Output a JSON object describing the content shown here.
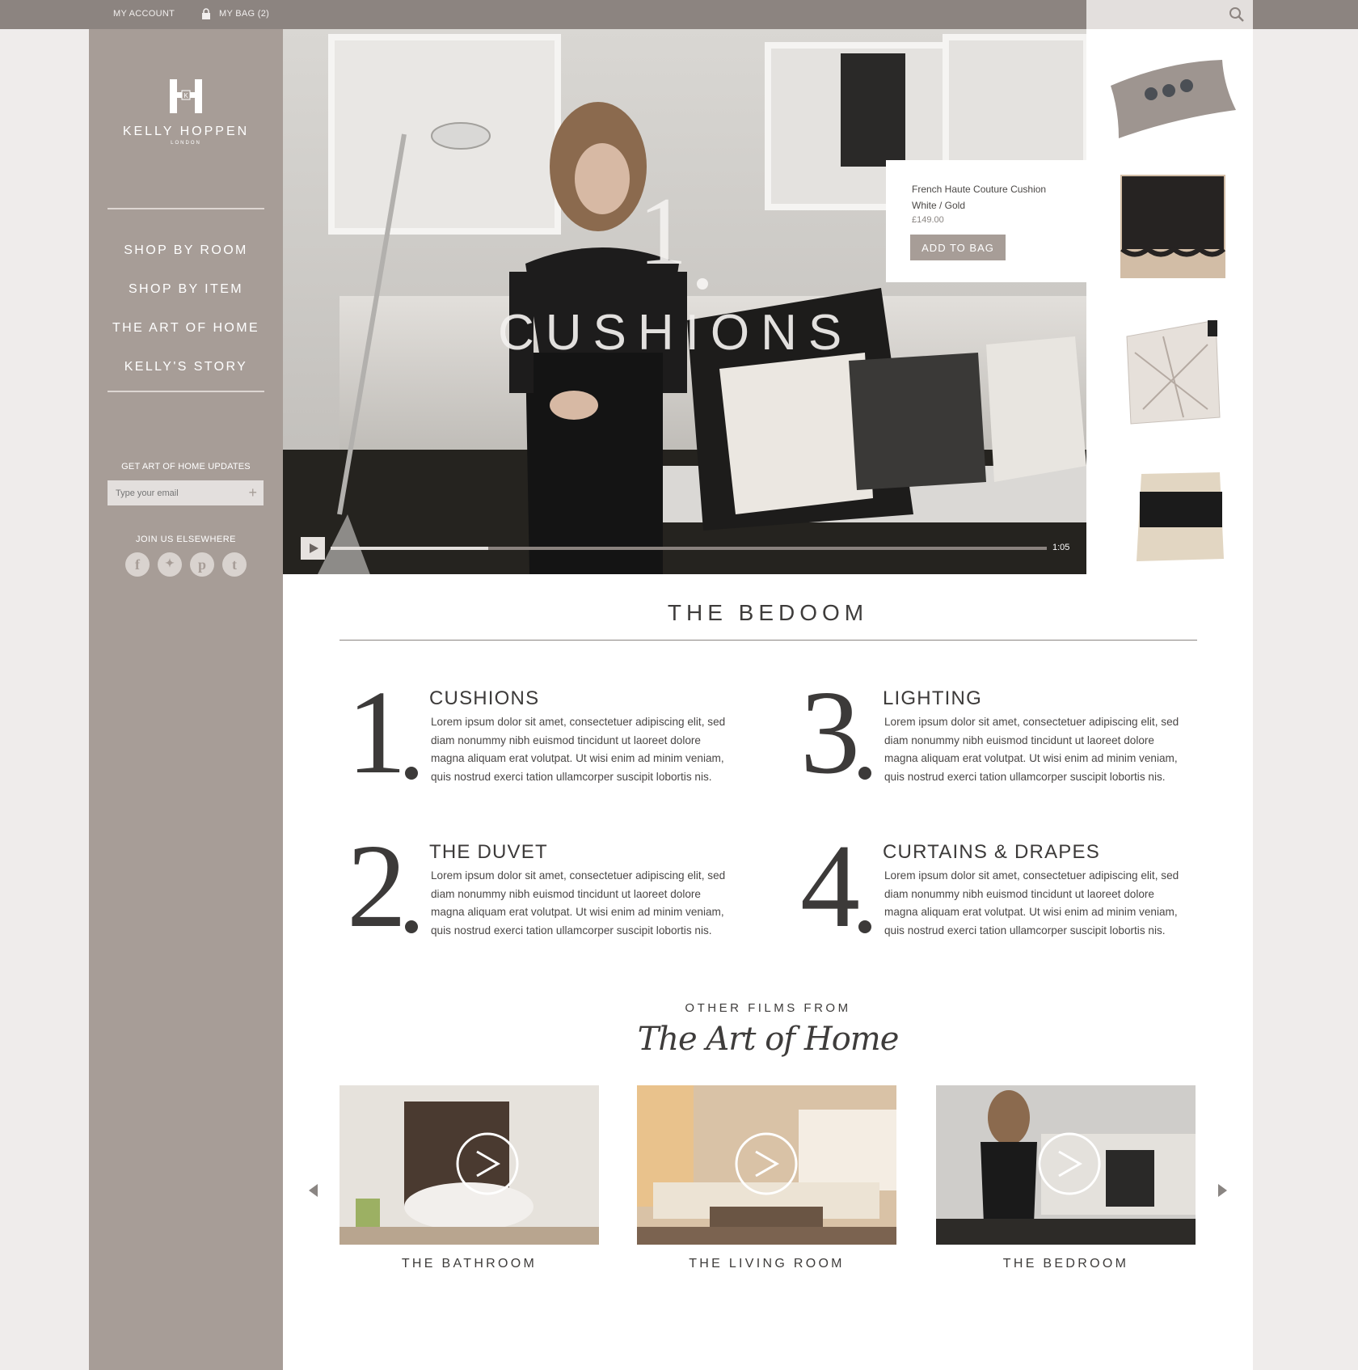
{
  "topbar": {
    "my_account": "MY ACCOUNT",
    "my_bag": "MY BAG (2)"
  },
  "brand": {
    "name": "KELLY HOPPEN",
    "sub": "LONDON"
  },
  "nav": [
    {
      "label": "SHOP BY ROOM"
    },
    {
      "label": "SHOP BY ITEM"
    },
    {
      "label": "THE ART OF HOME"
    },
    {
      "label": "KELLY'S STORY"
    }
  ],
  "newsletter": {
    "label": "GET ART OF HOME UPDATES",
    "placeholder": "Type your email"
  },
  "social": {
    "label": "JOIN US ELSEWHERE",
    "items": [
      "facebook-icon",
      "twitter-icon",
      "pinterest-icon",
      "tumblr-icon"
    ]
  },
  "video": {
    "number": "1",
    "title": "CUSHIONS",
    "time": "1:05",
    "progress": 0.22
  },
  "popup": {
    "name": "French Haute Couture Cushion",
    "variant": "White / Gold",
    "price": "£149.00",
    "button": "ADD TO BAG"
  },
  "section_title": "THE BEDOOM",
  "items": [
    {
      "num": "1",
      "title": "CUSHIONS",
      "text": "Lorem ipsum dolor sit amet, consectetuer adipiscing elit, sed diam nonummy nibh euismod tincidunt ut laoreet dolore magna aliquam erat volutpat. Ut wisi enim ad minim veniam, quis nostrud exerci tation ullamcorper suscipit lobortis nis."
    },
    {
      "num": "2",
      "title": "THE DUVET",
      "text": "Lorem ipsum dolor sit amet, consectetuer adipiscing elit, sed diam nonummy nibh euismod tincidunt ut laoreet dolore magna aliquam erat volutpat. Ut wisi enim ad minim veniam, quis nostrud exerci tation ullamcorper suscipit lobortis nis."
    },
    {
      "num": "3",
      "title": "LIGHTING",
      "text": "Lorem ipsum dolor sit amet, consectetuer adipiscing elit, sed diam nonummy nibh euismod tincidunt ut laoreet dolore magna aliquam erat volutpat. Ut wisi enim ad minim veniam, quis nostrud exerci tation ullamcorper suscipit lobortis nis."
    },
    {
      "num": "4",
      "title": "CURTAINS & DRAPES",
      "text": "Lorem ipsum dolor sit amet, consectetuer adipiscing elit, sed diam nonummy nibh euismod tincidunt ut laoreet dolore magna aliquam erat volutpat. Ut wisi enim ad minim veniam, quis nostrud exerci tation ullamcorper suscipit lobortis nis."
    }
  ],
  "films": {
    "heading": "OTHER FILMS FROM",
    "script": "The Art of Home",
    "items": [
      {
        "label": "THE BATHROOM"
      },
      {
        "label": "THE LIVING ROOM"
      },
      {
        "label": "THE BEDROOM"
      }
    ]
  },
  "colors": {
    "sidebar": "#a79d97",
    "topbar": "#8c8480",
    "text": "#3c3a39"
  }
}
